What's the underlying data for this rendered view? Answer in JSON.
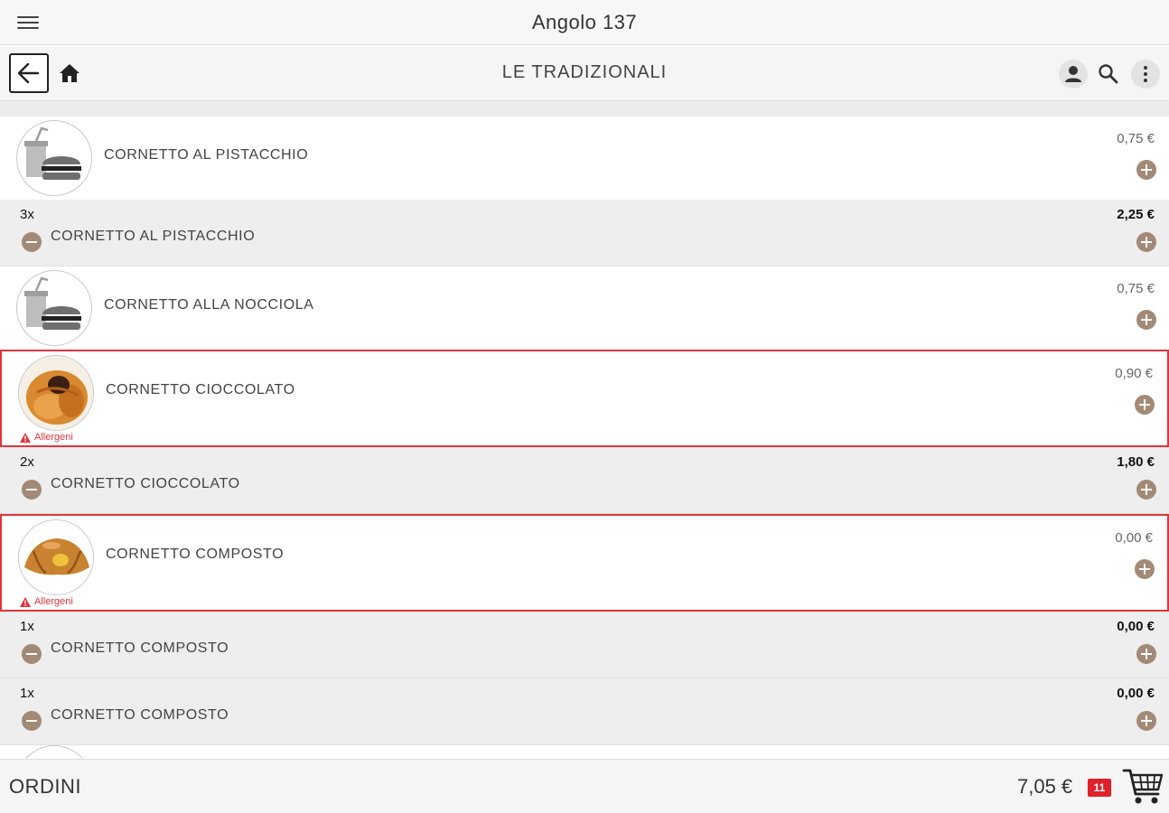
{
  "app": {
    "title": "Angolo 137"
  },
  "category": {
    "title": "LE TRADIZIONALI"
  },
  "list": {
    "p1": {
      "name": "CORNETTO AL PISTACCHIO",
      "price": "0,75 €"
    },
    "o1": {
      "qty": "3x",
      "name": "CORNETTO AL PISTACCHIO",
      "total": "2,25 €"
    },
    "p2": {
      "name": "CORNETTO ALLA NOCCIOLA",
      "price": "0,75 €"
    },
    "p3": {
      "name": "CORNETTO CIOCCOLATO",
      "price": "0,90 €",
      "allergen": "Allergeni"
    },
    "o2": {
      "qty": "2x",
      "name": "CORNETTO CIOCCOLATO",
      "total": "1,80 €"
    },
    "p4": {
      "name": "CORNETTO COMPOSTO",
      "price": "0,00 €",
      "allergen": "Allergeni"
    },
    "o3": {
      "qty": "1x",
      "name": "CORNETTO COMPOSTO",
      "total": "0,00 €"
    },
    "o4": {
      "qty": "1x",
      "name": "CORNETTO COMPOSTO",
      "total": "0,00 €"
    }
  },
  "footer": {
    "label": "ORDINI",
    "total": "7,05 €",
    "count": "11"
  },
  "icons": [
    "menu-icon",
    "back-arrow-icon",
    "home-icon",
    "user-icon",
    "search-icon",
    "more-vert-icon",
    "plus-icon",
    "minus-icon",
    "warning-icon",
    "cart-icon"
  ],
  "colors": {
    "accent": "#a38a76",
    "highlight": "#e0353b",
    "badge": "#e0202a"
  }
}
